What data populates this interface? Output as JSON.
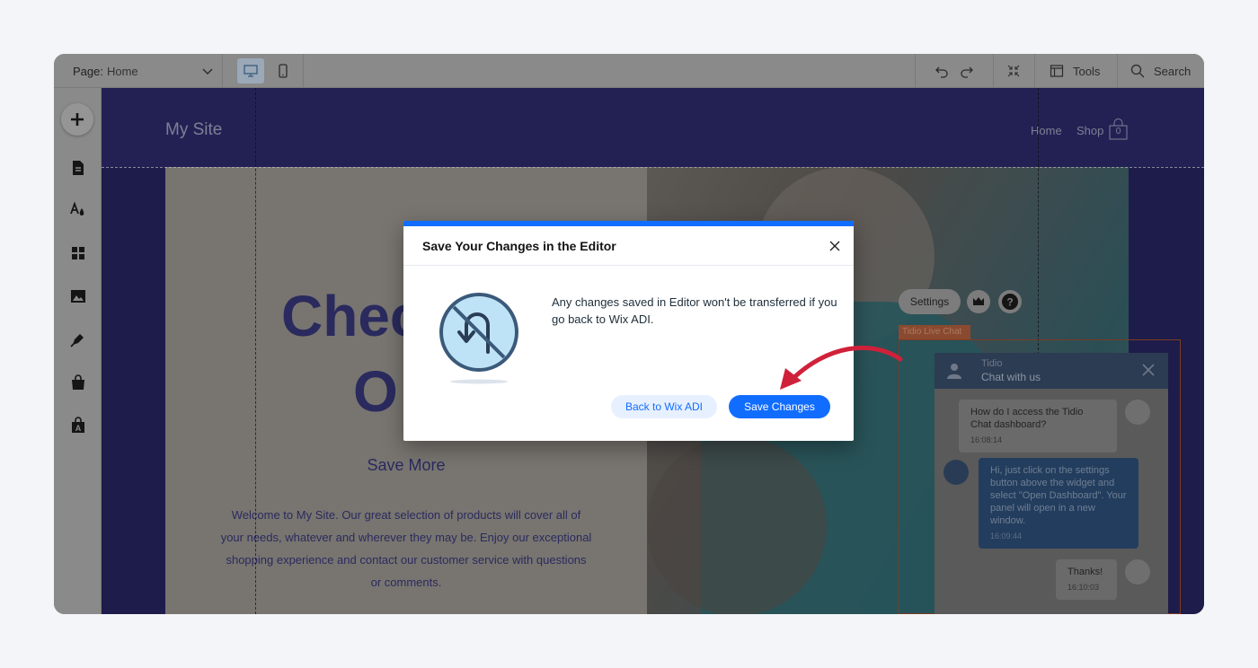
{
  "topbar": {
    "page_label": "Page:",
    "page_value": "Home",
    "tools_label": "Tools",
    "search_label": "Search"
  },
  "site": {
    "title": "My Site",
    "nav_home": "Home",
    "nav_shop": "Shop",
    "cart_count": "0",
    "hero_line1": "Chec",
    "hero_line2": "O",
    "hero_sub": "Save More",
    "hero_body": "Welcome to My Site. Our great selection of products will cover all of your needs, whatever and wherever they may be. Enjoy our exceptional shopping experience and contact our customer service with questions or comments."
  },
  "tidio": {
    "settings_label": "Settings",
    "tag": "Tidio Live Chat",
    "chat_name": "Tidio",
    "chat_sub": "Chat with us",
    "messages": [
      {
        "text": "How do I access the Tidio Chat dashboard?",
        "time": "16:08:14"
      },
      {
        "text": "Hi, just click on the settings button above the widget and select \"Open Dashboard\". Your panel will open in a new window.",
        "time": "16:09:44"
      },
      {
        "text": "Thanks!",
        "time": "16:10:03"
      }
    ]
  },
  "modal": {
    "title": "Save Your Changes in the Editor",
    "message": "Any changes saved in Editor won't be transferred if you go back to Wix ADI.",
    "back_label": "Back to Wix ADI",
    "save_label": "Save Changes"
  },
  "colors": {
    "accent": "#116dff",
    "arrow": "#d0213a"
  }
}
